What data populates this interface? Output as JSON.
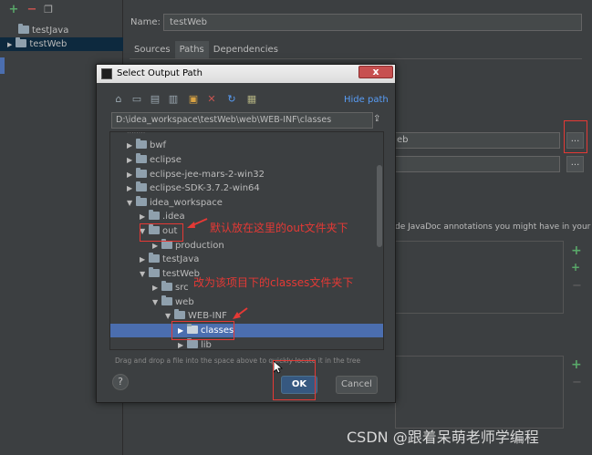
{
  "project_tree": {
    "items": [
      {
        "label": "testJava"
      },
      {
        "label": "testWeb"
      }
    ]
  },
  "settings": {
    "name_label": "Name:",
    "name_value": "testWeb",
    "tabs": [
      {
        "label": "Sources"
      },
      {
        "label": "Paths"
      },
      {
        "label": "Dependencies"
      }
    ],
    "field1_value": "eb",
    "dots_label": "...",
    "javadoc_text": "de JavaDoc annotations you might have in your"
  },
  "dialog": {
    "title": "Select Output Path",
    "close_label": "x",
    "hide_path": "Hide path",
    "path_value": "D:\\idea_workspace\\testWeb\\web\\WEB-INF\\classes",
    "tree": [
      {
        "label": "bwf"
      },
      {
        "label": "eclipse"
      },
      {
        "label": "eclipse-jee-mars-2-win32"
      },
      {
        "label": "eclipse-SDK-3.7.2-win64"
      },
      {
        "label": "idea_workspace"
      },
      {
        "label": ".idea"
      },
      {
        "label": "out"
      },
      {
        "label": "production"
      },
      {
        "label": "testJava"
      },
      {
        "label": "testWeb"
      },
      {
        "label": "src"
      },
      {
        "label": "web"
      },
      {
        "label": "WEB-INF"
      },
      {
        "label": "classes"
      },
      {
        "label": "lib"
      }
    ],
    "drag_hint": "Drag and drop a file into the space above to quickly locate it in the tree",
    "help_label": "?",
    "ok_label": "OK",
    "cancel_label": "Cancel"
  },
  "annotations": {
    "note1": "默认放在这里的out文件夹下",
    "note2": "改为该项目下的classes文件夹下"
  },
  "watermark": "CSDN @跟着呆萌老师学编程",
  "colors": {
    "background": "#3c3f41",
    "selection": "#4b6eaf",
    "annotation_red": "#e53935",
    "link_blue": "#589df6"
  }
}
